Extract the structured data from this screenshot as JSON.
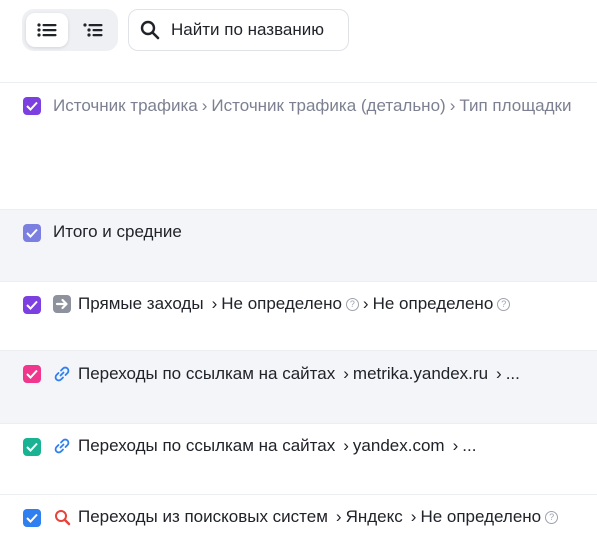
{
  "search": {
    "placeholder": "Найти по названию"
  },
  "colors": {
    "purple": "#7c3fe0",
    "lavender": "#7b7fe0",
    "pink": "#f0368d",
    "teal": "#19b394",
    "blue": "#2f7ff0",
    "link_icon": "#2f7ff0",
    "search_icon": "#e8423a",
    "direct_icon": "#8e929c"
  },
  "header_row": {
    "parts": [
      "Источник трафика",
      "Источник трафика (детально)",
      "Тип площадки"
    ],
    "separator": "›"
  },
  "totals_row": {
    "label": "Итого и средние"
  },
  "rows": [
    {
      "icon": "arrow-right-icon",
      "parts": [
        "Прямые заходы",
        "Не определено",
        "Не определено"
      ]
    },
    {
      "icon": "link-icon",
      "parts": [
        "Переходы по ссылкам на сайтах",
        "metrika.yandex.ru",
        "..."
      ]
    },
    {
      "icon": "link-icon",
      "parts": [
        "Переходы по ссылкам на сайтах",
        "yandex.com",
        "..."
      ]
    },
    {
      "icon": "search-icon",
      "parts": [
        "Переходы из поисковых систем",
        "Яндекс",
        "Не определено"
      ]
    }
  ],
  "help_mark": "?"
}
